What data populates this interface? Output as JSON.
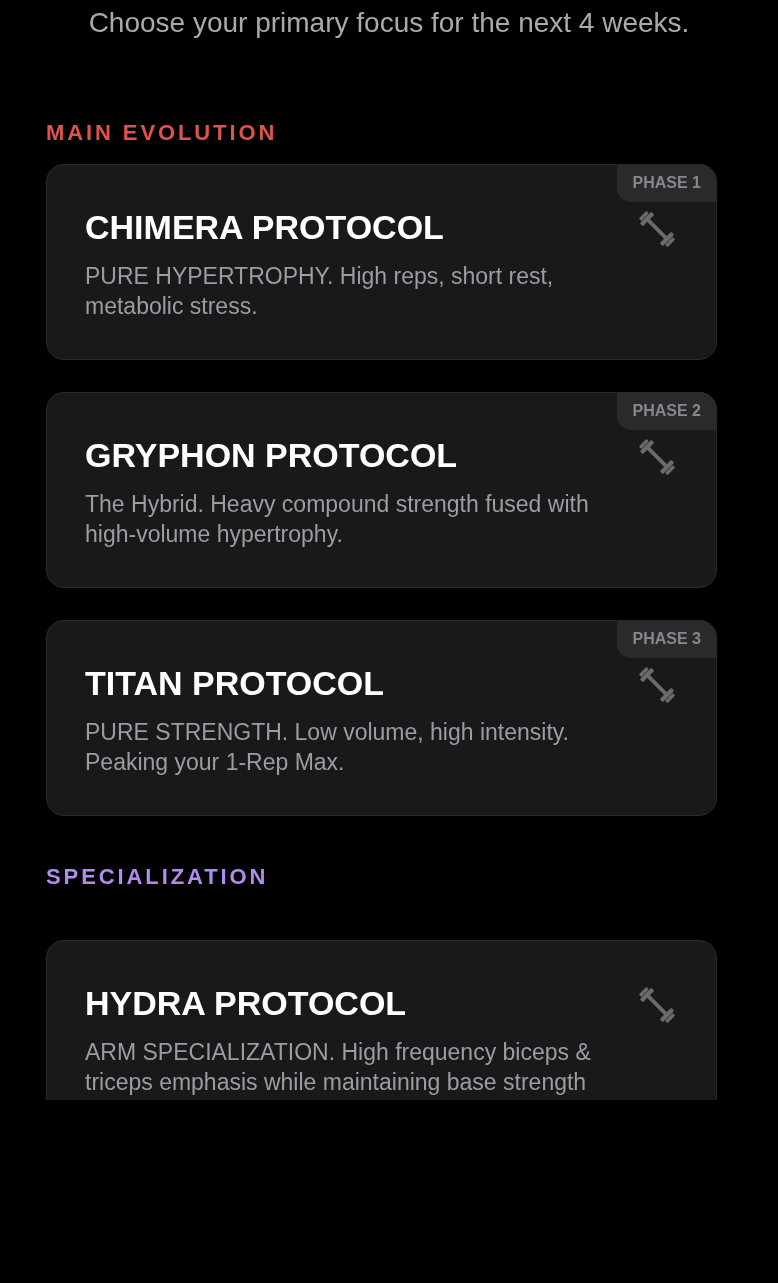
{
  "subtitle": "Choose your primary focus for the next 4 weeks.",
  "sections": [
    {
      "title": "MAIN EVOLUTION",
      "color": "#e0534d",
      "programs": [
        {
          "name": "CHIMERA PROTOCOL",
          "description": "PURE HYPERTROPHY. High reps, short rest, metabolic stress.",
          "phase": "PHASE 1"
        },
        {
          "name": "GRYPHON PROTOCOL",
          "description": "The Hybrid. Heavy compound strength fused with high-volume hypertrophy.",
          "phase": "PHASE 2"
        },
        {
          "name": "TITAN PROTOCOL",
          "description": "PURE STRENGTH. Low volume, high intensity. Peaking your 1-Rep Max.",
          "phase": "PHASE 3"
        }
      ]
    },
    {
      "title": "SPECIALIZATION",
      "color": "#b38bef",
      "programs": [
        {
          "name": "HYDRA PROTOCOL",
          "description": "ARM SPECIALIZATION. High frequency biceps & triceps emphasis while maintaining base strength"
        }
      ]
    }
  ]
}
